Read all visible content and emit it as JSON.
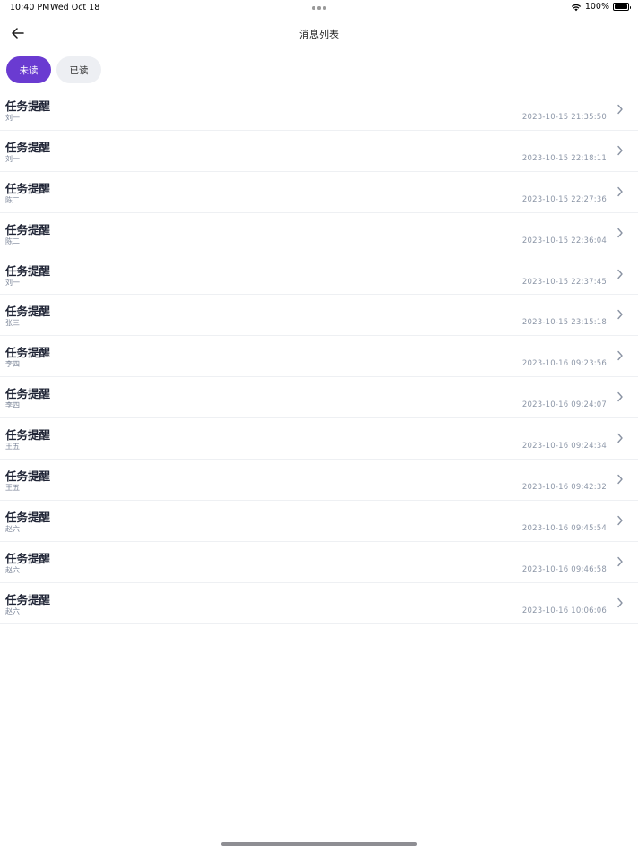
{
  "status_bar": {
    "time": "10:40 PM",
    "date": "Wed Oct 18",
    "battery": "100%",
    "battery_level": 1.0
  },
  "header": {
    "title": "消息列表",
    "back_icon": "arrow-left-icon"
  },
  "tabs": [
    {
      "label": "未读",
      "active": true
    },
    {
      "label": "已读",
      "active": false
    }
  ],
  "colors": {
    "accent": "#6a3bd1",
    "tab_inactive_bg": "#edeff3",
    "title_text": "#1f2435",
    "meta_text": "#8d97a8"
  },
  "messages": [
    {
      "title": "任务提醒",
      "sender": "刘一",
      "time": "2023-10-15 21:35:50"
    },
    {
      "title": "任务提醒",
      "sender": "刘一",
      "time": "2023-10-15 22:18:11"
    },
    {
      "title": "任务提醒",
      "sender": "陈二",
      "time": "2023-10-15 22:27:36"
    },
    {
      "title": "任务提醒",
      "sender": "陈二",
      "time": "2023-10-15 22:36:04"
    },
    {
      "title": "任务提醒",
      "sender": "刘一",
      "time": "2023-10-15 22:37:45"
    },
    {
      "title": "任务提醒",
      "sender": "张三",
      "time": "2023-10-15 23:15:18"
    },
    {
      "title": "任务提醒",
      "sender": "李四",
      "time": "2023-10-16 09:23:56"
    },
    {
      "title": "任务提醒",
      "sender": "李四",
      "time": "2023-10-16 09:24:07"
    },
    {
      "title": "任务提醒",
      "sender": "王五",
      "time": "2023-10-16 09:24:34"
    },
    {
      "title": "任务提醒",
      "sender": "王五",
      "time": "2023-10-16 09:42:32"
    },
    {
      "title": "任务提醒",
      "sender": "赵六",
      "time": "2023-10-16 09:45:54"
    },
    {
      "title": "任务提醒",
      "sender": "赵六",
      "time": "2023-10-16 09:46:58"
    },
    {
      "title": "任务提醒",
      "sender": "赵六",
      "time": "2023-10-16 10:06:06"
    }
  ]
}
